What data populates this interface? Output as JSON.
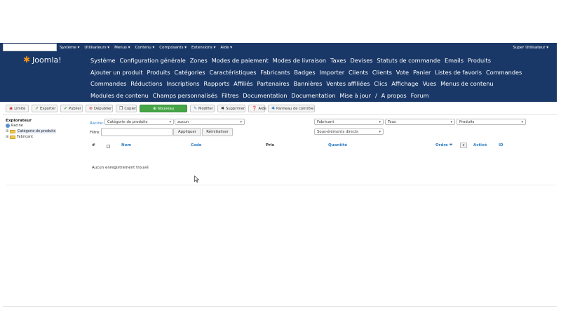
{
  "topbar": {
    "menus": [
      "Système ▾",
      "Utilisateurs ▾",
      "Menus ▾",
      "Contenu ▾",
      "Composants ▾",
      "Extensions ▾",
      "Aide ▾"
    ],
    "user": "Super Utilisateur ▾"
  },
  "header": {
    "brand": "Joomla!",
    "nav": [
      "Système",
      "Configuration générale",
      "Zones",
      "Modes de paiement",
      "Modes de livraison",
      "Taxes",
      "Devises",
      "Statuts de commande",
      "Emails",
      "Produits",
      "Ajouter un produit",
      "Produits",
      "Catégories",
      "Caractéristiques",
      "Fabricants",
      "Badges",
      "Importer",
      "Clients",
      "Clients",
      "Vote",
      "Panier",
      "Listes de favoris",
      "Commandes",
      "Commandes",
      "Réductions",
      "Inscriptions",
      "Rapports",
      "Affiliés",
      "Partenaires",
      "Bannières",
      "Ventes affiliées",
      "Clics",
      "Affichage",
      "Vues",
      "Menus de contenu",
      "Modules de contenu",
      "Champs personnalisés",
      "Filtres",
      "Documentation",
      "Documentation",
      "Mise à jour",
      "/",
      "A propos",
      "Forum"
    ]
  },
  "toolbar": {
    "limite": "Limite",
    "exporter": "Exporter",
    "publier": "Publier",
    "depublier": "Dépublier",
    "copier": "Copier",
    "nouveau": "Nouveau",
    "modifier": "Modifier",
    "supprimer": "Supprimer",
    "aide": "Aide",
    "panneau": "Panneau de contrôle"
  },
  "explorer": {
    "title": "Explorateur",
    "root": "Racine",
    "items": [
      "Catégorie de produits",
      "Fabricant"
    ]
  },
  "filters": {
    "racine_label": "Racine:",
    "categorie": "Catégorie de produits",
    "aucun": "aucun",
    "filtre_label": "Filtre:",
    "appliquer": "Appliquer",
    "reinitialiser": "Réinitialiser",
    "fabricant": "Fabricant",
    "tous": "Tous",
    "produits": "Produits",
    "sous_elements": "Sous-éléments directs"
  },
  "table": {
    "headers": {
      "hash": "#",
      "nom": "Nom",
      "code": "Code",
      "prix": "Prix",
      "quantite": "Quantité",
      "ordre": "Ordre ❤",
      "tiny": "x",
      "active": "Activé",
      "id": "ID"
    },
    "empty": "Aucun enregistrement trouvé"
  },
  "colors": {
    "header_bg": "#1a3867",
    "link": "#2f7ec2",
    "green": "#46a546"
  }
}
